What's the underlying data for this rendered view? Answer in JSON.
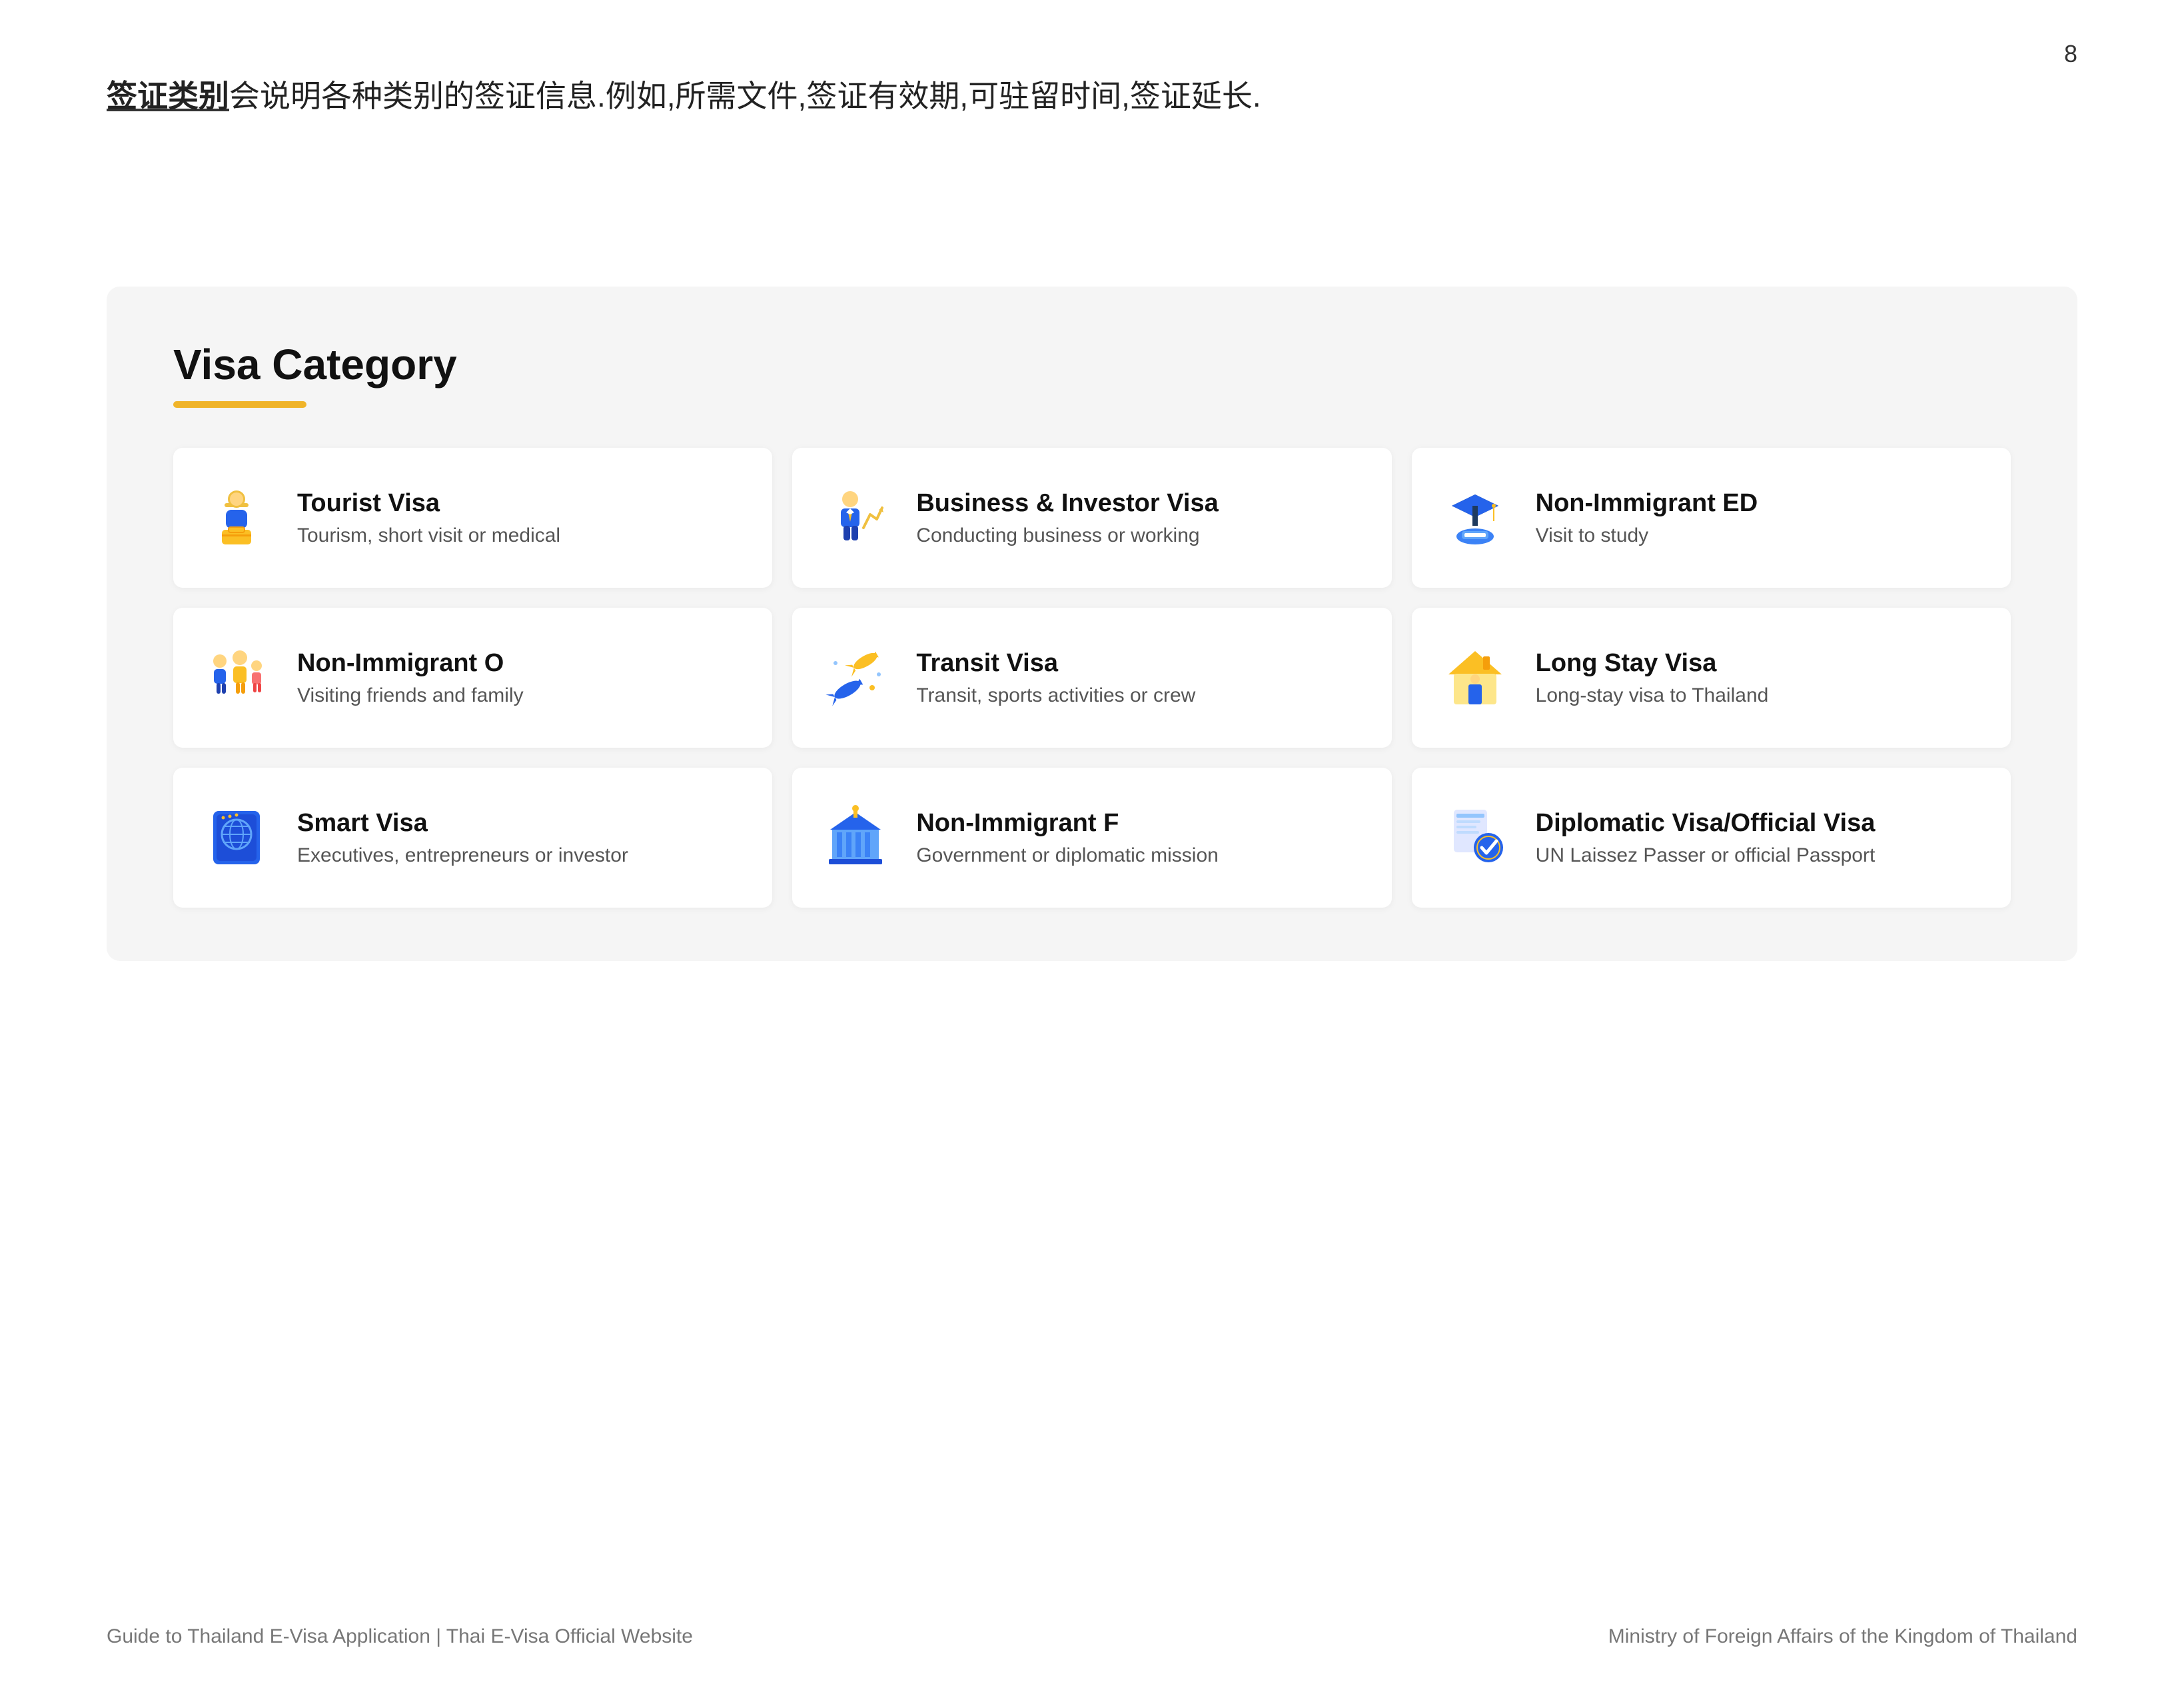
{
  "page": {
    "number": "8",
    "intro": {
      "highlight": "签证类别",
      "rest": "会说明各种类别的签证信息.例如,所需文件,签证有效期,可驻留时间,签证延长."
    },
    "visa_category": {
      "title": "Visa Category",
      "cards": [
        {
          "id": "tourist",
          "title": "Tourist Visa",
          "desc": "Tourism, short visit or medical"
        },
        {
          "id": "business",
          "title": "Business & Investor Visa",
          "desc": "Conducting business or working"
        },
        {
          "id": "ed",
          "title": "Non-Immigrant ED",
          "desc": "Visit to study"
        },
        {
          "id": "o",
          "title": "Non-Immigrant O",
          "desc": "Visiting friends and family"
        },
        {
          "id": "transit",
          "title": "Transit Visa",
          "desc": "Transit, sports activities or crew"
        },
        {
          "id": "longstay",
          "title": "Long Stay Visa",
          "desc": "Long-stay visa to Thailand"
        },
        {
          "id": "smart",
          "title": "Smart Visa",
          "desc": "Executives, entrepreneurs or investor"
        },
        {
          "id": "f",
          "title": "Non-Immigrant F",
          "desc": "Government or diplomatic mission"
        },
        {
          "id": "diplomatic",
          "title": "Diplomatic Visa/Official Visa",
          "desc": "UN Laissez Passer or official Passport"
        }
      ]
    },
    "footer": {
      "left": "Guide to Thailand E-Visa Application | Thai E-Visa Official Website",
      "right": "Ministry of Foreign Affairs of the Kingdom of Thailand"
    }
  }
}
